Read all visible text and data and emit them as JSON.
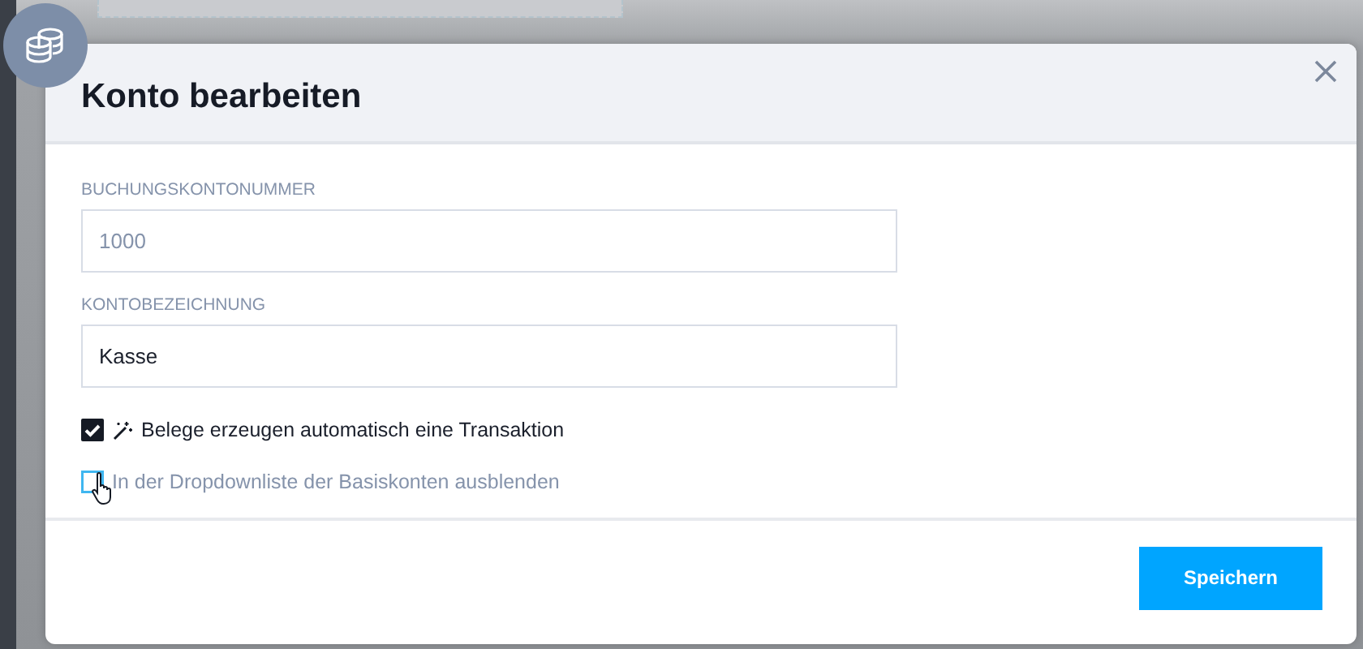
{
  "dialog": {
    "title": "Konto bearbeiten",
    "fields": [
      {
        "label": "BUCHUNGSKONTONUMMER",
        "value": "1000",
        "disabled": true
      },
      {
        "label": "KONTOBEZEICHNUNG",
        "value": "Kasse",
        "disabled": false
      }
    ],
    "options": [
      {
        "label": "Belege erzeugen automatisch eine Transaktion",
        "checked": true,
        "kind": "magic"
      },
      {
        "label": "In der Dropdownliste der Basiskonten ausblenden",
        "checked": false,
        "kind": "plain"
      }
    ],
    "buttons": [
      "Speichern"
    ]
  }
}
